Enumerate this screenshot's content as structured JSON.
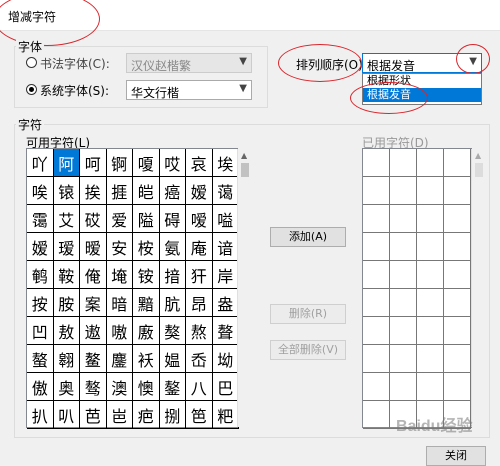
{
  "window": {
    "title": "增减字符"
  },
  "font_group": {
    "legend": "字体",
    "calligraphy_label": "书法字体(C):",
    "calligraphy_value": "汉仪赵楷繁",
    "system_label": "系统字体(S):",
    "system_value": "华文行楷"
  },
  "sort": {
    "label": "排列顺序(O):",
    "value": "根据发音",
    "options": [
      "根据形状",
      "根据发音"
    ]
  },
  "char_group": {
    "legend": "字符",
    "available_label": "可用字符(L)",
    "used_label": "已用字符(D)",
    "available_rows": [
      [
        "吖",
        "阿",
        "呵",
        "锕",
        "嗄",
        "哎",
        "哀",
        "埃"
      ],
      [
        "唉",
        "锿",
        "挨",
        "捱",
        "皑",
        "癌",
        "嫒",
        "蔼"
      ],
      [
        "霭",
        "艾",
        "砹",
        "爱",
        "隘",
        "碍",
        "嗳",
        "嗌"
      ],
      [
        "嫒",
        "瑷",
        "暧",
        "安",
        "桉",
        "氨",
        "庵",
        "谙"
      ],
      [
        "鹌",
        "鞍",
        "俺",
        "埯",
        "铵",
        "揞",
        "犴",
        "岸"
      ],
      [
        "按",
        "胺",
        "案",
        "暗",
        "黯",
        "肮",
        "昂",
        "盎"
      ],
      [
        "凹",
        "敖",
        "遨",
        "嗷",
        "廒",
        "獒",
        "熬",
        "聱"
      ],
      [
        "螯",
        "翱",
        "鳌",
        "鏖",
        "袄",
        "媪",
        "岙",
        "坳"
      ],
      [
        "傲",
        "奥",
        "骜",
        "澳",
        "懊",
        "鏊",
        "八",
        "巴"
      ],
      [
        "扒",
        "叭",
        "芭",
        "岜",
        "疤",
        "捌",
        "笆",
        "粑"
      ]
    ]
  },
  "buttons": {
    "add": "添加(A)",
    "delete": "删除(R)",
    "delete_all": "全部删除(V)",
    "close": "关闭"
  },
  "watermark": "Baidu经验"
}
